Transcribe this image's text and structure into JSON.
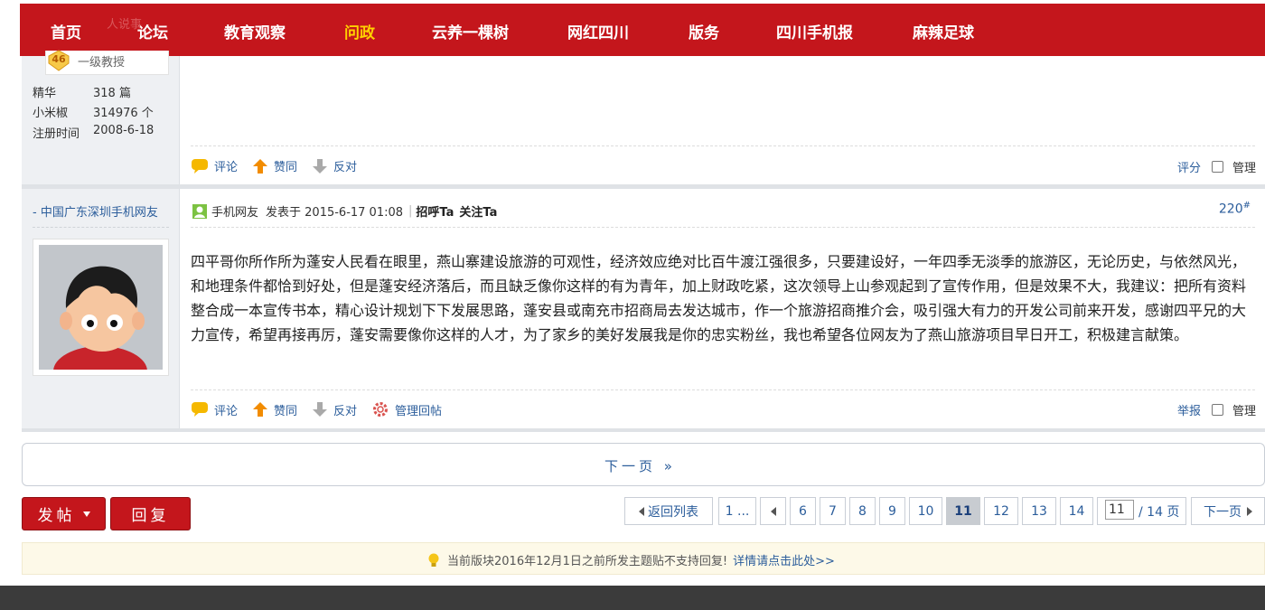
{
  "nav": {
    "items": [
      "首页",
      "论坛",
      "教育观察",
      "问政",
      "云养一棵树",
      "网红四川",
      "版务",
      "四川手机报",
      "麻辣足球"
    ],
    "active_index": 3,
    "overlap_text": "人说事"
  },
  "post1": {
    "rank_level": "46",
    "rank_title": "一级教授",
    "stats": [
      {
        "label": "精华",
        "value": "318 篇"
      },
      {
        "label": "小米椒",
        "value": "314976 个"
      },
      {
        "label": "注册时间",
        "value": "2008-6-18"
      }
    ],
    "actions": {
      "comment": "评论",
      "agree": "赞同",
      "oppose": "反对"
    },
    "right": {
      "rate": "评分",
      "manage": "管理"
    }
  },
  "post2": {
    "location": "- 中国广东深圳手机网友",
    "author": "手机网友",
    "posted": "发表于 2015-6-17 01:08",
    "greet": "招呼Ta",
    "follow": "关注Ta",
    "floor_num": "220",
    "floor_mark": "#",
    "body": "四平哥你所作所为蓬安人民看在眼里，燕山寨建设旅游的可观性，经济效应绝对比百牛渡江强很多，只要建设好，一年四季无淡季的旅游区，无论历史，与依然风光，和地理条件都恰到好处，但是蓬安经济落后，而且缺乏像你这样的有为青年，加上财政吃紧，这次领导上山参观起到了宣传作用，但是效果不大，我建议：把所有资料整合成一本宣传书本，精心设计规划下下发展思路，蓬安县或南充市招商局去发达城市，作一个旅游招商推介会，吸引强大有力的开发公司前来开发，感谢四平兄的大力宣传，希望再接再厉，蓬安需要像你这样的人才，为了家乡的美好发展我是你的忠实粉丝，我也希望各位网友为了燕山旅游项目早日开工，积极建言献策。",
    "actions": {
      "comment": "评论",
      "agree": "赞同",
      "oppose": "反对",
      "admin_reply": "管理回帖"
    },
    "right": {
      "report": "举报",
      "manage": "管理"
    }
  },
  "nextbar": {
    "label": "下一页 »"
  },
  "buttons": {
    "post": "发帖",
    "reply": "回复"
  },
  "pager": {
    "back": "返回列表",
    "first": "1 ...",
    "pages": [
      "6",
      "7",
      "8",
      "9",
      "10",
      "11",
      "12",
      "13",
      "14"
    ],
    "current": "11",
    "input_value": "11",
    "total": "/ 14 页",
    "next": "下一页"
  },
  "notice": {
    "text": "当前版块2016年12月1日之前所发主题贴不支持回复!",
    "link": "详情请点击此处>>"
  },
  "colors": {
    "brand_red": "#c4161c",
    "active_nav": "#ffd200",
    "link_blue": "#2b5d9b"
  }
}
